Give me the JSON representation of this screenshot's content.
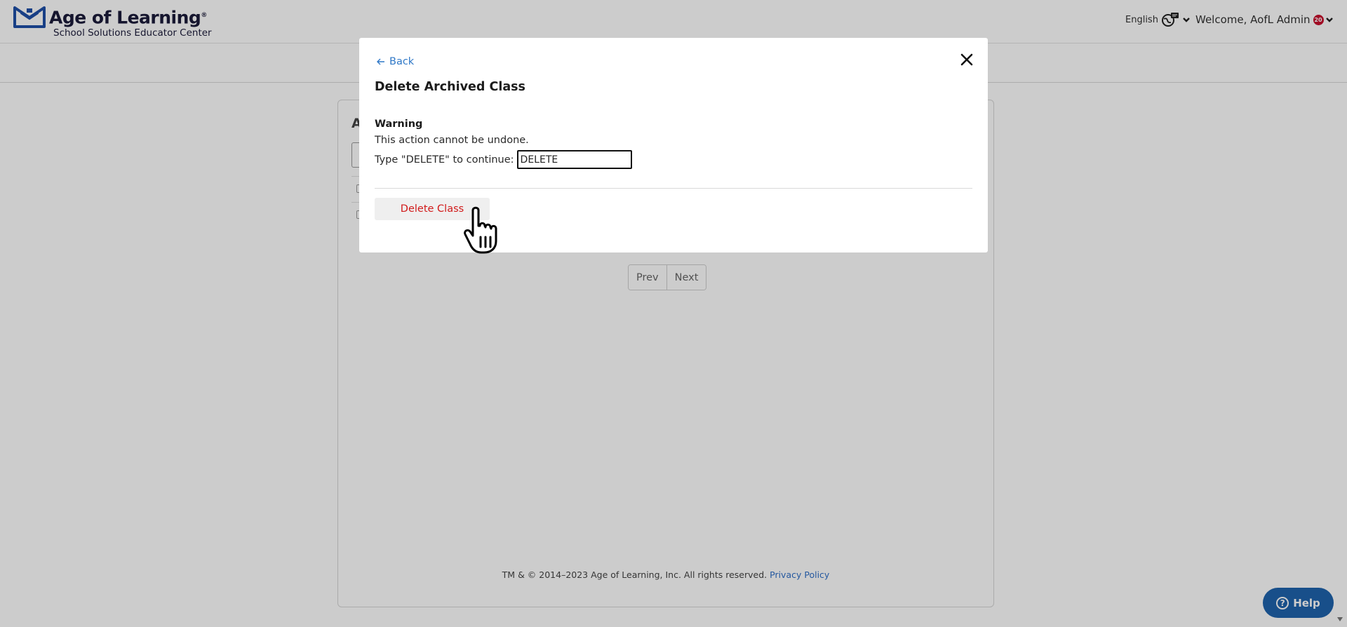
{
  "header": {
    "brand_title": "Age of Learning",
    "brand_mark": "®",
    "brand_subtitle": "School Solutions Educator Center",
    "language": "English",
    "welcome": "Welcome, AofL Admin",
    "notification_count": "20"
  },
  "page": {
    "card_title_fragment": "A",
    "pagination": {
      "prev": "Prev",
      "next": "Next"
    },
    "footer_text": "TM & © 2014–2023 Age of Learning, Inc. All rights reserved.",
    "footer_link": "Privacy Policy",
    "help_label": "Help"
  },
  "modal": {
    "back_label": "Back",
    "title": "Delete Archived Class",
    "warning_title": "Warning",
    "warning_text": "This action cannot be undone.",
    "confirm_prompt": "Type \"DELETE\" to continue:",
    "confirm_value": "DELETE",
    "delete_button": "Delete Class"
  },
  "colors": {
    "brand_navy": "#1b1b3a",
    "link_blue": "#2f78c7",
    "danger_red": "#d11a1a",
    "help_blue": "#1f63ad",
    "badge_red": "#c8102e"
  },
  "icons": {
    "logo": "aofl-logo-icon",
    "language": "language-globe-icon",
    "dropdown": "chevron-down-icon",
    "back": "arrow-left-icon",
    "close": "close-icon",
    "help": "question-circle-icon",
    "cursor": "hand-pointer-cursor-icon"
  }
}
